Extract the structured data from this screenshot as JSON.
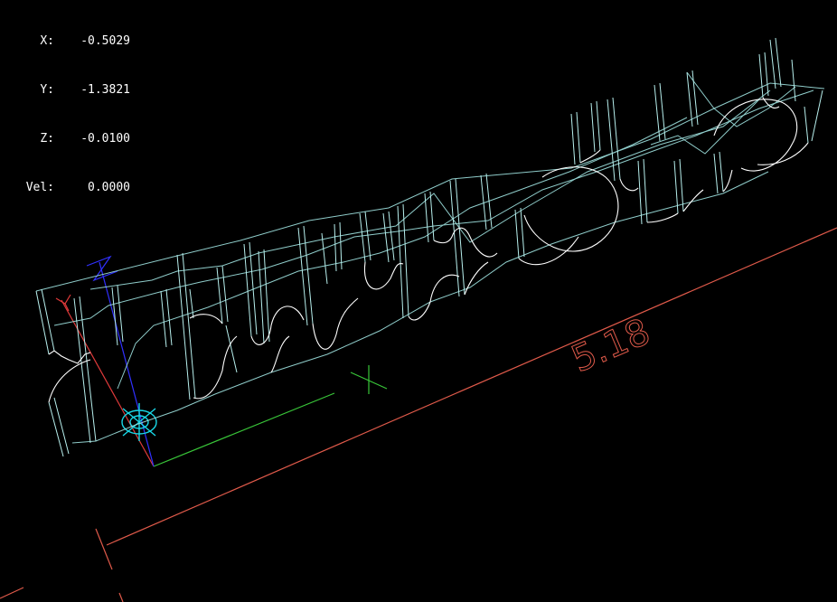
{
  "dro": [
    {
      "label": "X:",
      "value": "-0.5029"
    },
    {
      "label": "Y:",
      "value": "-1.3821"
    },
    {
      "label": "Z:",
      "value": "-0.0100"
    },
    {
      "label": "Vel:",
      "value": "0.0000"
    }
  ],
  "dimension": {
    "value": "5.18"
  },
  "axis_labels": {
    "x": "X",
    "y": "Y",
    "z": "Z"
  },
  "colors": {
    "background": "#000000",
    "toolpath": "#b8f0ee",
    "feed": "#ffffff",
    "extents": "#e05a4a",
    "axis_x": "#39c639",
    "axis_y": "#e03a3a",
    "axis_z": "#3030ff",
    "tool": "#19d7e6"
  }
}
